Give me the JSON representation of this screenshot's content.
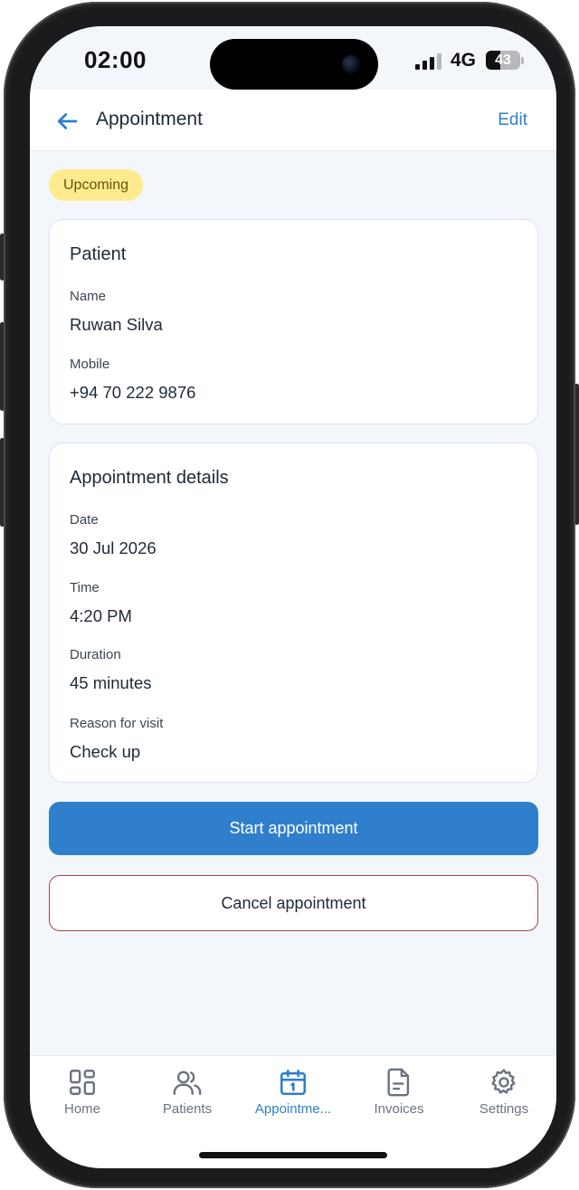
{
  "status_bar": {
    "time": "02:00",
    "network": "4G",
    "battery_level": "43",
    "battery_fraction": 0.43
  },
  "app_bar": {
    "back_icon": "arrow-left-icon",
    "title": "Appointment",
    "edit_label": "Edit"
  },
  "status_badge": "Upcoming",
  "patient_card": {
    "title": "Patient",
    "name_label": "Name",
    "name_value": "Ruwan Silva",
    "mobile_label": "Mobile",
    "mobile_value": "+94 70 222 9876"
  },
  "details_card": {
    "title": "Appointment details",
    "date_label": "Date",
    "date_value": "30 Jul 2026",
    "time_label": "Time",
    "time_value": "4:20 PM",
    "duration_label": "Duration",
    "duration_value": "45 minutes",
    "reason_label": "Reason for visit",
    "reason_value": "Check up"
  },
  "actions": {
    "start_label": "Start appointment",
    "cancel_label": "Cancel appointment"
  },
  "bottom_nav": {
    "items": [
      {
        "label": "Home",
        "icon": "grid-icon",
        "active": false
      },
      {
        "label": "Patients",
        "icon": "users-icon",
        "active": false
      },
      {
        "label": "Appointme...",
        "icon": "calendar-icon",
        "active": true
      },
      {
        "label": "Invoices",
        "icon": "document-icon",
        "active": false
      },
      {
        "label": "Settings",
        "icon": "gear-icon",
        "active": false
      }
    ]
  },
  "colors": {
    "accent": "#2f7fcc",
    "badge_bg": "#fdeb8e",
    "danger_border": "#a7474d",
    "screen_bg": "#f3f6fb"
  }
}
